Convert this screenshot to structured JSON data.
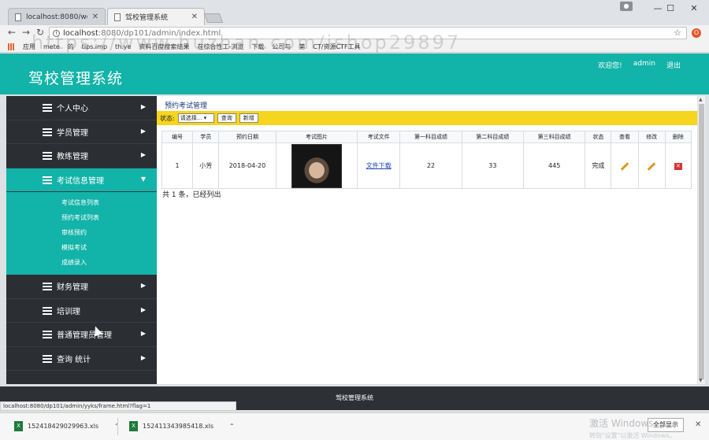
{
  "browser": {
    "tabs": [
      {
        "title": "localhost:8080/webtoo"
      },
      {
        "title": "驾校管理系统"
      }
    ],
    "url_host": "localhost",
    "url_path": ":8080/dp101/admin/index.html",
    "bookmarks": [
      "应用",
      "mete",
      "的",
      "tips.imp",
      "th.ye",
      "资料百度搜索结果",
      "在综合性工-浏览",
      "下载",
      "公司与",
      "第",
      "CT/资源CTF工具"
    ],
    "watermark_overlay": "https://www.huzhan.com/ishop29897"
  },
  "header": {
    "title": "驾校管理系统",
    "welcome": "欢迎您!",
    "user": "admin",
    "logout": "退出"
  },
  "sidebar": {
    "items": [
      {
        "label": "个人中心"
      },
      {
        "label": "学员管理"
      },
      {
        "label": "教练管理"
      },
      {
        "label": "考试信息管理"
      },
      {
        "label": "财务管理"
      },
      {
        "label": "培训理"
      },
      {
        "label": "普通管理员管理"
      },
      {
        "label": "查询 统计"
      }
    ],
    "submenu": [
      "考试信息列表",
      "预约考试列表",
      "审核预约",
      "模拟考试",
      "成绩录入"
    ]
  },
  "content": {
    "title": "预约考试管理",
    "filter_label": "状态:",
    "filter_select": "请选择...",
    "search_button": "查询",
    "add_button": "新增",
    "columns": [
      "编号",
      "学员",
      "预约日期",
      "考试图片",
      "考试文件",
      "第一科目成绩",
      "第二科目成绩",
      "第三科目成绩",
      "状态",
      "查看",
      "修改",
      "删除"
    ],
    "rows": [
      {
        "id": "1",
        "student": "小芳",
        "date": "2018-04-20",
        "file": "文件下载",
        "score1": "22",
        "score2": "33",
        "score3": "445",
        "status": "完成"
      }
    ],
    "record_count": "共 1 条，已经列出"
  },
  "footer": {
    "text": "驾校管理系统"
  },
  "statusbar": {
    "url": "localhost:8080/dp101/admin/yyks/frame.html?flag=1"
  },
  "downloads": {
    "files": [
      "152418429029963.xls",
      "152411343985418.xls"
    ],
    "show_all": "全部显示",
    "windows_watermark": "激活 Windows",
    "windows_watermark_sub": "转到\"设置\"以激活 Windows。"
  }
}
